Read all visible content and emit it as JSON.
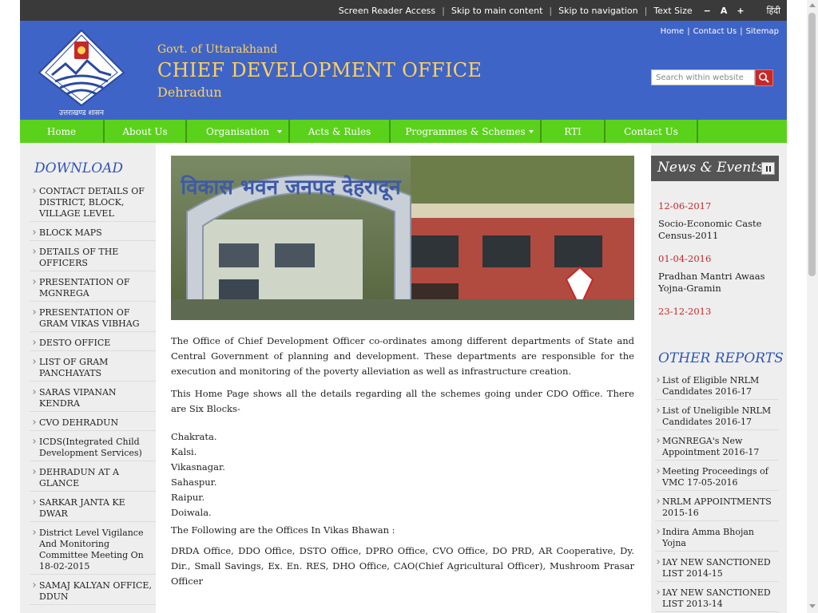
{
  "topbar": {
    "screen_reader": "Screen Reader Access",
    "skip_main": "Skip to main content",
    "skip_nav": "Skip to navigation",
    "text_size": "Text Size",
    "minus": "−",
    "a": "A",
    "plus": "+",
    "hindi": "हिंदी"
  },
  "header": {
    "govt": "Govt. of Uttarakhand",
    "office": "CHIEF DEVELOPMENT OFFICE",
    "city": "Dehradun",
    "logo_caption": "उत्तराखण्ड शासन",
    "links": [
      "Home",
      "Contact Us",
      "Sitemap"
    ],
    "search_placeholder": "Search within website",
    "brand_color": "#3f64c8",
    "title_color": "#ffd25a"
  },
  "nav": {
    "items": [
      "Home",
      "About Us",
      "Organisation",
      "Acts & Rules",
      "Programmes & Schemes",
      "RTI",
      "Contact Us"
    ],
    "color": "#5ad21b"
  },
  "left": {
    "heading": "DOWNLOAD",
    "items": [
      "CONTACT DETAILS OF DISTRICT, BLOCK, VILLAGE LEVEL",
      "BLOCK MAPS",
      "DETAILS OF THE OFFICERS",
      "PRESENTATION OF MGNREGA",
      "PRESENTATION OF GRAM VIKAS VIBHAG",
      "DESTO OFFICE",
      "LIST OF GRAM PANCHAYATS",
      "SARAS VIPANAN KENDRA",
      "CVO DEHRADUN",
      "ICDS(Integrated Child Development Services)",
      "DEHRADUN AT A GLANCE",
      "SARKAR JANTA KE DWAR",
      "District Level Vigilance And Monitoring Committee Meeting On 18-02-2015",
      "SAMAJ KALYAN OFFICE, DDUN"
    ]
  },
  "main": {
    "photo_sign": "विकास भवन जनपद देहरादून",
    "intro": "The Office of Chief Development Officer co-ordinates among different departments of State and Central Government of planning and development. These departments are responsible for the execution and monitoring of the poverty alleviation as well as infrastructure creation.",
    "schemes": "This Home Page shows all the details regarding all the schemes going under CDO Office. There are Six Blocks-",
    "blocks": [
      "Chakrata.",
      "Kalsi.",
      "Vikasnagar.",
      "Sahaspur.",
      "Raipur.",
      "Doiwala."
    ],
    "offices_heading": "The Following are the Offices In Vikas Bhawan :",
    "offices": "DRDA Office, DDO Office, DSTO Office, DPRO Office, CVO Office, DO PRD, AR Cooperative, Dy. Dir., Small Savings, Ex. En. RES, DHO Office, CAO(Chief Agricultural Officer), Mushroom Prasar Officer"
  },
  "right": {
    "news_heading": "News & Events",
    "news": [
      {
        "date": "12-06-2017",
        "title": "Socio-Economic Caste Census-2011"
      },
      {
        "date": "01-04-2016",
        "title": "Pradhan Mantri Awaas Yojna-Gramin"
      },
      {
        "date": "23-12-2013",
        "title": ""
      }
    ],
    "reports_heading": "OTHER REPORTS",
    "reports": [
      "List of Eligible NRLM Candidates 2016-17",
      "List of Uneligible NRLM Candidates 2016-17",
      "MGNREGA's New Appointment 2016-17",
      "Meeting Proceedings of VMC 17-05-2016",
      "NRLM APPOINTMENTS 2015-16",
      "Indira Amma Bhojan Yojna",
      "IAY NEW SANCTIONED LIST 2014-15",
      "IAY NEW SANCTIONED LIST 2013-14"
    ]
  }
}
